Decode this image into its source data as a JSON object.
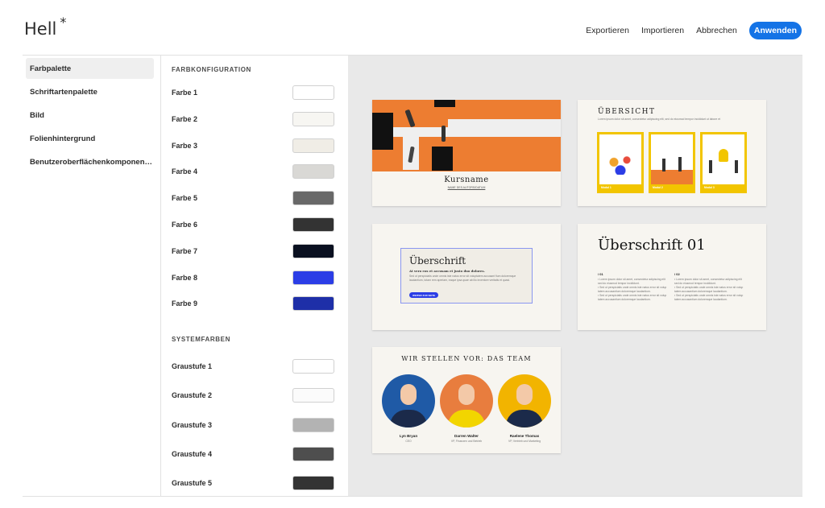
{
  "header": {
    "title": "Hell",
    "unsaved_marker": "*",
    "actions": {
      "export": "Exportieren",
      "import": "Importieren",
      "cancel": "Abbrechen",
      "apply": "Anwenden"
    }
  },
  "nav": {
    "items": [
      {
        "label": "Farbpalette",
        "active": true
      },
      {
        "label": "Schriftartenpalette",
        "active": false
      },
      {
        "label": "Bild",
        "active": false
      },
      {
        "label": "Folienhintergrund",
        "active": false
      },
      {
        "label": "Benutzeroberflächenkomponen…",
        "active": false
      }
    ]
  },
  "config": {
    "color_section": "FARBKONFIGURATION",
    "colors": [
      {
        "label": "Farbe 1",
        "hex": "#ffffff"
      },
      {
        "label": "Farbe 2",
        "hex": "#f7f6f2"
      },
      {
        "label": "Farbe 3",
        "hex": "#f0ede6"
      },
      {
        "label": "Farbe 4",
        "hex": "#d9d8d5"
      },
      {
        "label": "Farbe 5",
        "hex": "#686868"
      },
      {
        "label": "Farbe 6",
        "hex": "#333333"
      },
      {
        "label": "Farbe 7",
        "hex": "#0a1020"
      },
      {
        "label": "Farbe 8",
        "hex": "#2b3de6"
      },
      {
        "label": "Farbe 9",
        "hex": "#1e2fa8"
      }
    ],
    "system_section": "SYSTEMFARBEN",
    "grays": [
      {
        "label": "Graustufe 1",
        "hex": "#ffffff"
      },
      {
        "label": "Graustufe 2",
        "hex": "#fbfbfb"
      },
      {
        "label": "Graustufe 3",
        "hex": "#b3b3b3"
      },
      {
        "label": "Graustufe 4",
        "hex": "#4e4e4e"
      },
      {
        "label": "Graustufe 5",
        "hex": "#333333"
      }
    ]
  },
  "preview": {
    "slide1": {
      "title": "Kursname",
      "subtitle": "NAME DES AUTORS/DATUM"
    },
    "slide2": {
      "title": "ÜBERSICHT",
      "text": "Lorem ipsum dolor sit amet, consectetur adipiscing elit, sed do eiusmod tempor incididunt ut labore et",
      "modules": [
        "Modul 1",
        "Modul 2",
        "Modul 3"
      ]
    },
    "slide3": {
      "title": "Überschrift",
      "subtitle": "At vero eos et accusam et justo duo dolores.",
      "text": "Sed ut perspiciatis unde omnis iste natus error sit voluptatem accusant fium doloremque laudantium, totam rem aperiam, eaque ipsa quae ab illo inventore veritatis et quasi.",
      "button": "WEITER ZUR SEITE"
    },
    "slide4": {
      "title": "Überschrift 01",
      "col1_head": "/ 01",
      "col2_head": "/ 02",
      "bullets": [
        "Lorem ipsum dolor sit amet, consectetur adipiscing elit sed do eiusmod tempor incididunt.",
        "Sed ut perspiciatis unde omnis iste natus error sit volup tatem accusantium doloremque laudantium.",
        "Sed ut perspiciatis unde omnis iste natus error sit volup tatem accusantium doloremque laudantium."
      ]
    },
    "slide5": {
      "title": "WIR STELLEN VOR: DAS TEAM",
      "people": [
        {
          "name": "Lyn Bryan",
          "role": "CEO",
          "color": "#1f5aa6"
        },
        {
          "name": "Darren Walter",
          "role": "VP, Finanzen und Betrieb",
          "color": "#e87d3e"
        },
        {
          "name": "Raelene Thomas",
          "role": "VP, Vertrieb und Marketing",
          "color": "#f2b400"
        }
      ]
    }
  }
}
